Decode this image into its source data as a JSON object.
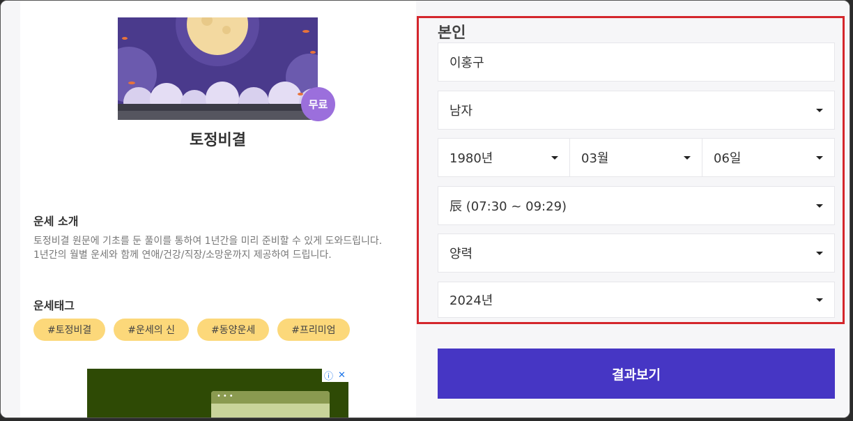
{
  "product": {
    "badge": "무료",
    "title": "토정비결"
  },
  "intro": {
    "heading": "운세 소개",
    "line1": "토정비결 원문에 기초를 둔 풀이를 통하여 1년간을 미리 준비할 수 있게 도와드립니다.",
    "line2": "1년간의 월별 운세와 함께 연애/건강/직장/소망운까지 제공하여 드립니다."
  },
  "tags": {
    "heading": "운세태그",
    "items": [
      "#토정비결",
      "#운세의 신",
      "#동양운세",
      "#프리미엄"
    ]
  },
  "form": {
    "heading": "본인",
    "name_value": "이홍구",
    "gender_value": "남자",
    "year_value": "1980년",
    "month_value": "03월",
    "day_value": "06일",
    "hour_value": "辰 (07:30 ~ 09:29)",
    "calendar_value": "양력",
    "target_year_value": "2024년"
  },
  "submit_label": "결과보기",
  "ad": {
    "info_icon": "ⓘ",
    "close_icon": "✕"
  },
  "colors": {
    "accent": "#4636c4",
    "tag": "#fcd87a",
    "badge": "#9b6fdc",
    "highlight": "#d4262c"
  }
}
